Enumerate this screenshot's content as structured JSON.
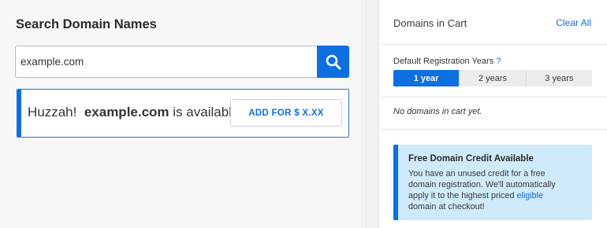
{
  "search": {
    "title": "Search Domain Names",
    "query": "example.com",
    "button_icon": "search-icon",
    "result": {
      "prefix": "Huzzah!",
      "domain": "example.com",
      "suffix": "is available!",
      "add_label": "ADD FOR $ X.XX"
    }
  },
  "cart": {
    "title": "Domains in Cart",
    "clear_label": "Clear All",
    "registration_label": "Default Registration Years",
    "registration_help": "?",
    "years": [
      {
        "label": "1 year",
        "selected": true
      },
      {
        "label": "2 years",
        "selected": false
      },
      {
        "label": "3 years",
        "selected": false
      }
    ],
    "empty_message": "No domains in cart yet.",
    "credit": {
      "title": "Free Domain Credit Available",
      "body_line1": "You have an unused credit for a free",
      "body_line2": "domain registration. We'll automatically",
      "body_line3": "apply it to the highest priced",
      "link": "eligible",
      "body_line4": "domain at checkout!"
    }
  },
  "colors": {
    "accent": "#0d6fe0",
    "credit_bg": "#cfeafa",
    "panel_bg": "#f7f7f8"
  }
}
